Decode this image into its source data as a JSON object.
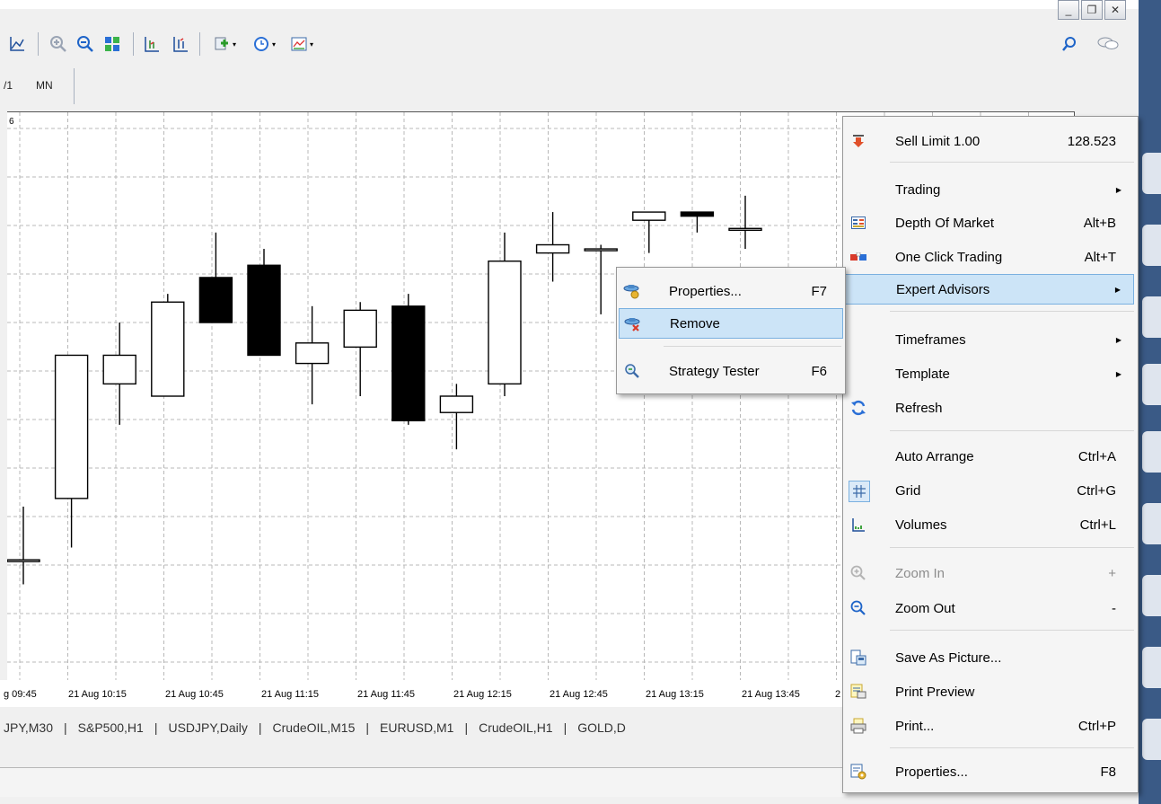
{
  "window_controls": [
    "_",
    "❐",
    "✕"
  ],
  "toolbar": {
    "icons": [
      "line-chart-icon",
      "zoom-in-icon",
      "zoom-out-icon",
      "tile-windows-icon",
      "chart-shift-icon",
      "autoscroll-icon",
      "indicators-icon",
      "periods-icon",
      "templates-icon",
      "search-icon",
      "chat-icon"
    ]
  },
  "periodbar": {
    "left_label": "/1",
    "mn_label": "MN"
  },
  "chart": {
    "corner_label": "6",
    "x_labels": [
      "g 09:45",
      "21 Aug 10:15",
      "21 Aug 10:45",
      "21 Aug 11:15",
      "21 Aug 11:45",
      "21 Aug 12:15",
      "21 Aug 12:45",
      "21 Aug 13:15",
      "21 Aug 13:45",
      "2"
    ]
  },
  "chart_data": {
    "type": "candlestick",
    "candles": [
      {
        "open": 117.5,
        "high": 118.8,
        "low": 116.9,
        "close": 117.5
      },
      {
        "open": 119.0,
        "high": 122.4,
        "low": 117.8,
        "close": 122.5
      },
      {
        "open": 121.8,
        "high": 123.3,
        "low": 120.8,
        "close": 122.5
      },
      {
        "open": 121.5,
        "high": 124.0,
        "low": 121.5,
        "close": 123.8
      },
      {
        "open": 124.4,
        "high": 125.5,
        "low": 123.9,
        "close": 123.3
      },
      {
        "open": 124.7,
        "high": 125.1,
        "low": 122.5,
        "close": 122.5
      },
      {
        "open": 122.3,
        "high": 123.7,
        "low": 121.3,
        "close": 122.8
      },
      {
        "open": 122.7,
        "high": 123.8,
        "low": 121.5,
        "close": 123.6
      },
      {
        "open": 123.7,
        "high": 124.0,
        "low": 120.8,
        "close": 120.9
      },
      {
        "open": 121.1,
        "high": 121.8,
        "low": 120.2,
        "close": 121.5
      },
      {
        "open": 121.8,
        "high": 125.5,
        "low": 121.5,
        "close": 124.8
      },
      {
        "open": 125.0,
        "high": 126.0,
        "low": 124.3,
        "close": 125.2
      },
      {
        "open": 125.1,
        "high": 125.2,
        "low": 123.5,
        "close": 125.1
      },
      {
        "open": 125.8,
        "high": 126.0,
        "low": 125.0,
        "close": 126.0
      },
      {
        "open": 126.0,
        "high": 126.0,
        "low": 125.5,
        "close": 125.9
      },
      {
        "open": 125.6,
        "high": 126.4,
        "low": 125.1,
        "close": 125.6
      }
    ]
  },
  "tabs": [
    "JPY,M30",
    "S&P500,H1",
    "USDJPY,Daily",
    "CrudeOIL,M15",
    "EURUSD,M1",
    "CrudeOIL,H1",
    "GOLD,D"
  ],
  "menu": {
    "sell_limit": {
      "label": "Sell Limit 1.00",
      "value": "128.523"
    },
    "trading": "Trading",
    "depth_of_market": {
      "label": "Depth Of Market",
      "shortcut": "Alt+B"
    },
    "one_click": {
      "label": "One Click Trading",
      "shortcut": "Alt+T"
    },
    "expert_advisors": "Expert Advisors",
    "timeframes": "Timeframes",
    "template": "Template",
    "refresh": "Refresh",
    "auto_arrange": {
      "label": "Auto Arrange",
      "shortcut": "Ctrl+A"
    },
    "grid": {
      "label": "Grid",
      "shortcut": "Ctrl+G"
    },
    "volumes": {
      "label": "Volumes",
      "shortcut": "Ctrl+L"
    },
    "zoom_in": {
      "label": "Zoom In",
      "shortcut": "+"
    },
    "zoom_out": {
      "label": "Zoom Out",
      "shortcut": "-"
    },
    "save_picture": "Save As Picture...",
    "print_preview": "Print Preview",
    "print": {
      "label": "Print...",
      "shortcut": "Ctrl+P"
    },
    "properties": {
      "label": "Properties...",
      "shortcut": "F8"
    }
  },
  "submenu": {
    "properties": {
      "label": "Properties...",
      "shortcut": "F7"
    },
    "remove": "Remove",
    "strategy_tester": {
      "label": "Strategy Tester",
      "shortcut": "F6"
    }
  }
}
